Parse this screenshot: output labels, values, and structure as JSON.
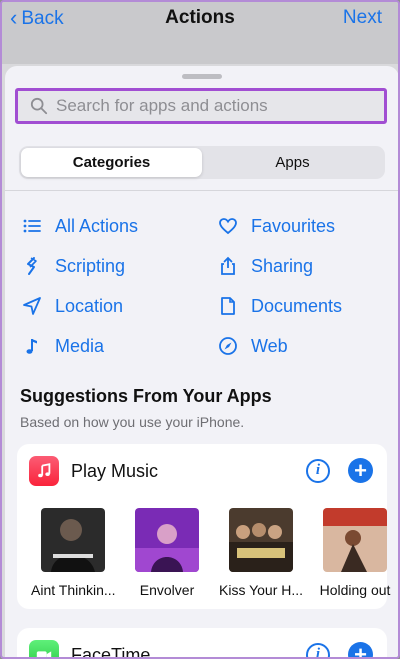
{
  "nav": {
    "back_label": "Back",
    "title": "Actions",
    "next_label": "Next"
  },
  "search": {
    "placeholder": "Search for apps and actions",
    "value": ""
  },
  "segmented": {
    "categories_label": "Categories",
    "apps_label": "Apps",
    "selected": "Categories"
  },
  "categories": [
    {
      "label": "All Actions",
      "icon": "list-icon"
    },
    {
      "label": "Favourites",
      "icon": "heart-icon"
    },
    {
      "label": "Scripting",
      "icon": "scripting-icon"
    },
    {
      "label": "Sharing",
      "icon": "share-icon"
    },
    {
      "label": "Location",
      "icon": "location-arrow-icon"
    },
    {
      "label": "Documents",
      "icon": "document-icon"
    },
    {
      "label": "Media",
      "icon": "music-note-icon"
    },
    {
      "label": "Web",
      "icon": "compass-icon"
    }
  ],
  "suggestions": {
    "title": "Suggestions From Your Apps",
    "subtitle": "Based on how you use your iPhone.",
    "apps": [
      {
        "name": "Play Music",
        "icon": "music-app-icon",
        "items": [
          "Aint Thinkin...",
          "Envolver",
          "Kiss Your H...",
          "Holding out"
        ]
      },
      {
        "name": "FaceTime",
        "icon": "facetime-app-icon"
      }
    ]
  },
  "colors": {
    "accent": "#1a73e8",
    "highlight_border": "#a14ed2"
  }
}
